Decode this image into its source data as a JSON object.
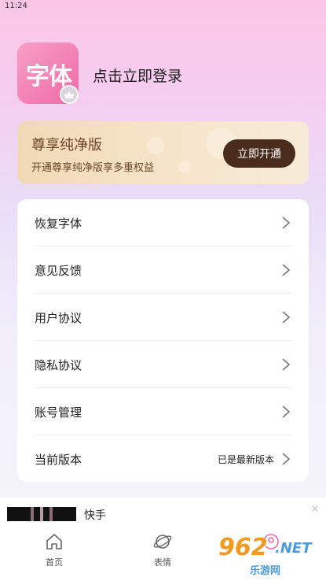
{
  "status_bar": {
    "time": "11:24"
  },
  "profile": {
    "logo_text": "字体",
    "login_text": "点击立即登录"
  },
  "vip": {
    "title": "尊享纯净版",
    "subtitle": "开通尊享纯净版享多重权益",
    "button_label": "立即开通"
  },
  "menu": {
    "items": [
      {
        "label": "恢复字体"
      },
      {
        "label": "意见反馈"
      },
      {
        "label": "用户协议"
      },
      {
        "label": "隐私协议"
      },
      {
        "label": "账号管理"
      },
      {
        "label": "当前版本",
        "value": "已是最新版本"
      }
    ]
  },
  "ad": {
    "title": "快手",
    "close": "×"
  },
  "bottom_nav": {
    "items": [
      {
        "label": "首页",
        "icon": "home-icon"
      },
      {
        "label": "表情",
        "icon": "planet-icon"
      },
      {
        "label": "",
        "icon": "profile-icon"
      }
    ]
  },
  "watermark": {
    "number": "962",
    "domain": ".NET",
    "subtitle": "乐游网"
  },
  "colors": {
    "vip_button_bg": "#4a2c1d",
    "vip_text": "#6b4426",
    "logo_gradient_start": "#f79fc6",
    "logo_gradient_end": "#f06aa8",
    "watermark_orange": "#f39a1e",
    "watermark_blue": "#4c9be0"
  }
}
